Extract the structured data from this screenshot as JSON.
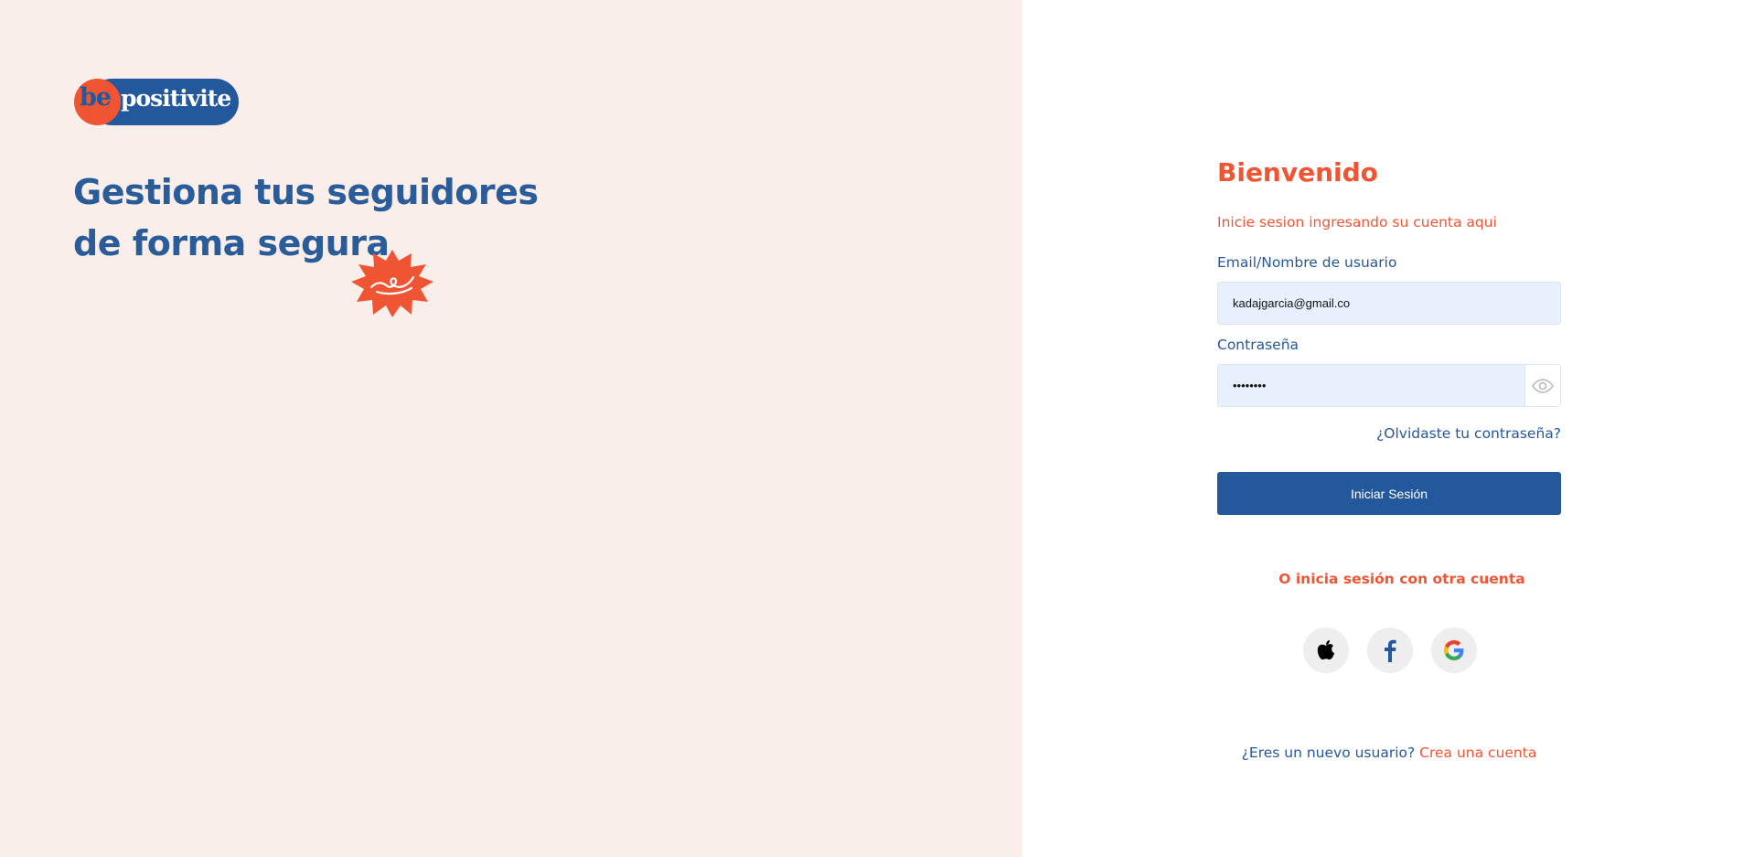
{
  "brand": {
    "logo_prefix": "be",
    "logo_name": "positivite",
    "colors": {
      "primary": "#24589c",
      "accent": "#ef5533",
      "left_bg": "#faeeeb"
    }
  },
  "hero": {
    "headline_line1": "Gestiona tus seguidores",
    "headline_line2": "de forma segura"
  },
  "login": {
    "title": "Bienvenido",
    "subtitle": "Inicie sesion ingresando su cuenta aqui",
    "email_label": "Email/Nombre de usuario",
    "email_value": "kadajgarcia@gmail.co",
    "password_label": "Contraseña",
    "password_value": "12345678",
    "forgot_link": "¿Olvidaste tu contraseña?",
    "submit_label": "Iniciar Sesión",
    "alt_login_text": "O inicia sesión con otra cuenta",
    "social": [
      {
        "name": "apple",
        "icon": "apple-icon"
      },
      {
        "name": "facebook",
        "icon": "facebook-icon"
      },
      {
        "name": "google",
        "icon": "google-icon"
      }
    ],
    "register_question": "¿Eres un nuevo usuario?",
    "register_link": "Crea una cuenta"
  }
}
